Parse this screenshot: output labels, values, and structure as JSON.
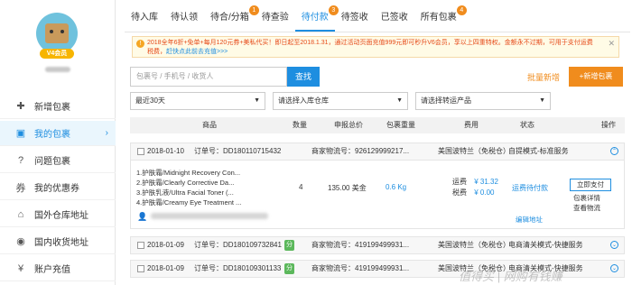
{
  "sidebar": {
    "vip_badge": "V4会员",
    "items": [
      {
        "label": "新增包裹",
        "icon": "plus-icon"
      },
      {
        "label": "我的包裹",
        "icon": "package-icon",
        "active": true
      },
      {
        "label": "问题包裹",
        "icon": "question-icon"
      },
      {
        "label": "我的优惠券",
        "icon": "coupon-icon"
      },
      {
        "label": "国外仓库地址",
        "icon": "warehouse-icon"
      },
      {
        "label": "国内收货地址",
        "icon": "location-icon"
      },
      {
        "label": "账户充值",
        "icon": "yen-icon"
      }
    ]
  },
  "tabs": [
    {
      "label": "待入库",
      "badge": ""
    },
    {
      "label": "待认领",
      "badge": ""
    },
    {
      "label": "待合/分箱",
      "badge": "1"
    },
    {
      "label": "待查验",
      "badge": ""
    },
    {
      "label": "待付款",
      "badge": "3"
    },
    {
      "label": "待签收",
      "badge": ""
    },
    {
      "label": "已签收",
      "badge": ""
    },
    {
      "label": "所有包裹",
      "badge": "4"
    }
  ],
  "notice": {
    "text": "2018全年6折+免单+每月120元券+美私代买！即日起至2018.1.31，通过活动页面充值999元即可秒升V6会员，享以上四重特权。金额永不过期，可用于支付运费",
    "text2": "税费，",
    "link": "赶快点此前去充值>>>"
  },
  "search": {
    "placeholder": "包裹号 / 手机号 / 收货人",
    "button": "查找",
    "batch": "批量新增",
    "add": "+新增包裹"
  },
  "filters": {
    "time": "最近30天",
    "warehouse": "请选择入库仓库",
    "product": "请选择转运产品"
  },
  "table_headers": [
    "商品",
    "数量",
    "申报总价",
    "包裹重量",
    "费用",
    "状态",
    "操作"
  ],
  "orders": [
    {
      "date": "2018-01-10",
      "order_no": "订单号：DD180110715432",
      "merchant_no": "商家物流号：926129999217...",
      "route": "美国波特兰（免税仓）",
      "service": "自提模式-标准服务",
      "items": [
        "1.护肤霜/Midnight Recovery Con...",
        "2.护肤霜/Clearly Corrective Da...",
        "3.护肤乳液/Ultra Facial Toner (...",
        "4.护肤霜/Creamy Eye Treatment ..."
      ],
      "qty": "4",
      "declared": "135.00 美金",
      "weight": "0.6 Kg",
      "fee_label1": "运费",
      "fee_value1": "¥ 31.32",
      "fee_label2": "税费",
      "fee_value2": "¥ 0.00",
      "status": "运费待付款",
      "pay": "立即支付",
      "detail": "包裹详情",
      "track": "查看物流",
      "edit_address": "编辑地址"
    },
    {
      "date": "2018-01-09",
      "order_no": "订单号：DD180109732841",
      "tag": "分",
      "merchant_no": "商家物流号：419199499931...",
      "route": "美国波特兰（免税仓）",
      "service": "电商清关模式-快捷服务"
    },
    {
      "date": "2018-01-09",
      "order_no": "订单号：DD180109301133",
      "tag": "分",
      "merchant_no": "商家物流号：419199499931...",
      "route": "美国波特兰（免税仓）",
      "service": "电商清关模式-快捷服务"
    }
  ],
  "watermark": "值得买 | 网购有钱赚"
}
